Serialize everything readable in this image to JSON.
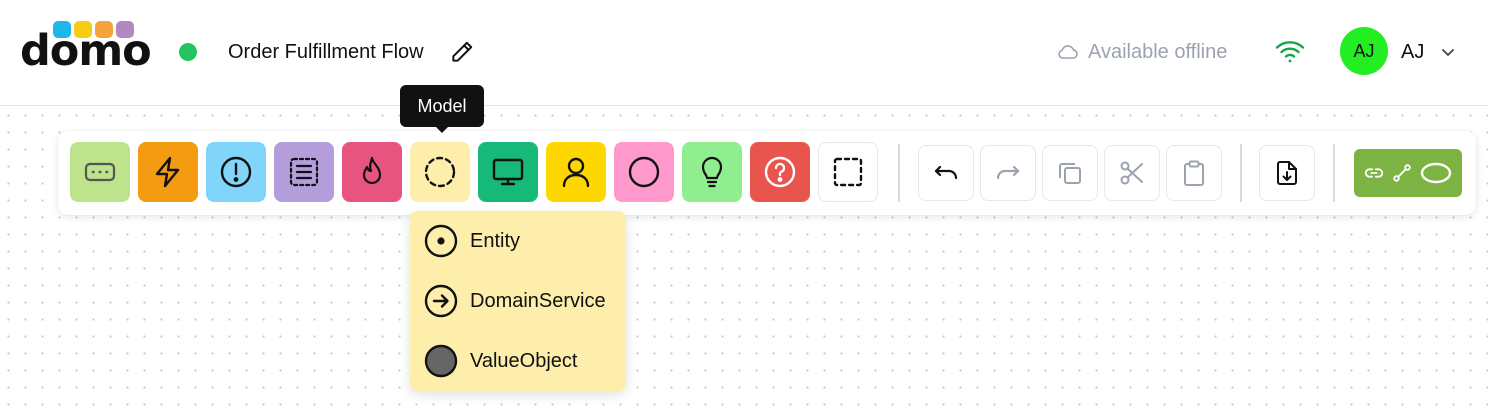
{
  "header": {
    "logo_text": "domo",
    "logo_dot_colors": [
      "#1fb6e8",
      "#f6cc15",
      "#f5a23a",
      "#b587c1"
    ],
    "status_color": "#22c55e",
    "flow_title": "Order Fulfillment Flow",
    "offline_label": "Available offline",
    "wifi_color": "#16a34a",
    "avatar_initials": "AJ",
    "avatar_color": "#22ee22",
    "user_name": "AJ"
  },
  "toolbar": {
    "tools": [
      {
        "name": "text-box-tool",
        "icon": "dots-box-icon",
        "bg": "#bde48d"
      },
      {
        "name": "event-tool",
        "icon": "lightning-icon",
        "bg": "#f39c12"
      },
      {
        "name": "warning-tool",
        "icon": "exclamation-circle-icon",
        "bg": "#81d4fa"
      },
      {
        "name": "list-tool",
        "icon": "list-box-icon",
        "bg": "#b39ddb"
      },
      {
        "name": "hotspot-tool",
        "icon": "flame-icon",
        "bg": "#e75480"
      },
      {
        "name": "model-tool",
        "icon": "dashed-circle-icon",
        "bg": "#fdeeab"
      },
      {
        "name": "ui-tool",
        "icon": "monitor-icon",
        "bg": "#17b978"
      },
      {
        "name": "actor-tool",
        "icon": "user-icon",
        "bg": "#ffd700"
      },
      {
        "name": "aggregate-tool",
        "icon": "circle-icon",
        "bg": "#ff99cc"
      },
      {
        "name": "idea-tool",
        "icon": "lightbulb-icon",
        "bg": "#90ee90"
      },
      {
        "name": "question-tool",
        "icon": "question-circle-icon",
        "bg": "#e8554e"
      },
      {
        "name": "boundary-tool",
        "icon": "dashed-square-icon",
        "bg": "#ffffff"
      }
    ],
    "actions": [
      {
        "name": "undo-button",
        "icon": "undo-icon",
        "enabled": true
      },
      {
        "name": "redo-button",
        "icon": "redo-icon",
        "enabled": false
      },
      {
        "name": "copy-button",
        "icon": "copy-icon",
        "enabled": false
      },
      {
        "name": "cut-button",
        "icon": "scissors-icon",
        "enabled": false
      },
      {
        "name": "paste-button",
        "icon": "clipboard-icon",
        "enabled": false
      },
      {
        "name": "export-button",
        "icon": "file-download-icon",
        "enabled": true
      }
    ],
    "connector_color": "#7cb342"
  },
  "tooltip": {
    "label": "Model"
  },
  "dropdown": {
    "bg": "#fdeeab",
    "items": [
      {
        "label": "Entity",
        "icon": "dot-circle-icon"
      },
      {
        "label": "DomainService",
        "icon": "arrow-circle-icon"
      },
      {
        "label": "ValueObject",
        "icon": "filled-circle-icon"
      }
    ]
  }
}
